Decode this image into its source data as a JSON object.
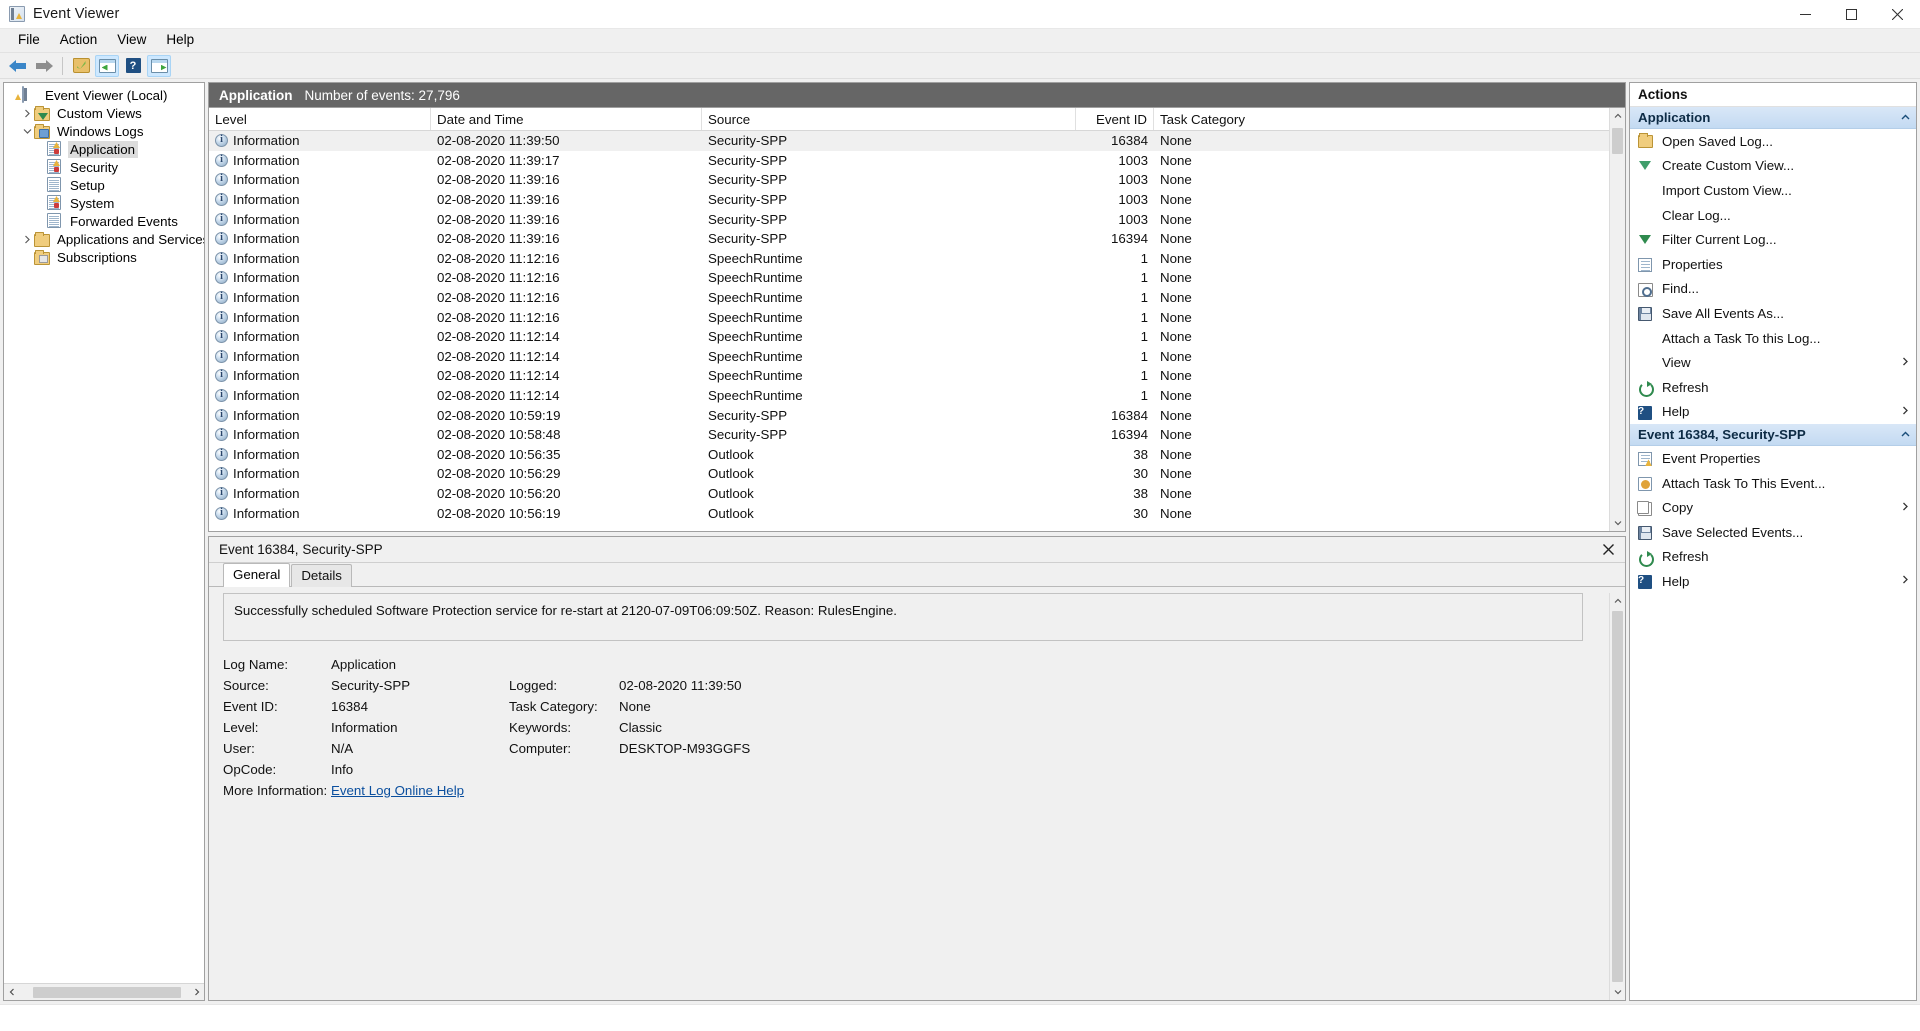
{
  "window": {
    "title": "Event Viewer",
    "icon": "event-viewer-icon",
    "minimize": "minimize-icon",
    "maximize": "maximize-icon",
    "close": "close-icon"
  },
  "menubar": {
    "items": [
      {
        "label": "File"
      },
      {
        "label": "Action"
      },
      {
        "label": "View"
      },
      {
        "label": "Help"
      }
    ]
  },
  "toolbar": {
    "buttons": [
      {
        "name": "back-button",
        "icon": "arrow-left-icon"
      },
      {
        "name": "forward-button",
        "icon": "arrow-right-icon"
      },
      {
        "name": "open-saved-log-button",
        "icon": "folder-open-icon"
      },
      {
        "name": "show-hide-console-tree-button",
        "icon": "console-tree-icon"
      },
      {
        "name": "help-button",
        "icon": "help-icon"
      },
      {
        "name": "show-hide-action-pane-button",
        "icon": "action-pane-icon"
      }
    ]
  },
  "tree": {
    "nodes": [
      {
        "label": "Event Viewer (Local)",
        "icon": "event-viewer-icon",
        "indent": 0,
        "twisty": "none",
        "selected": false
      },
      {
        "label": "Custom Views",
        "icon": "folder-filter-icon",
        "indent": 1,
        "twisty": "collapsed",
        "selected": false
      },
      {
        "label": "Windows Logs",
        "icon": "folder-computer-icon",
        "indent": 1,
        "twisty": "expanded",
        "selected": false
      },
      {
        "label": "Application",
        "icon": "log-warning-icon",
        "indent": 2,
        "twisty": "none",
        "selected": true
      },
      {
        "label": "Security",
        "icon": "log-warning-icon",
        "indent": 2,
        "twisty": "none",
        "selected": false
      },
      {
        "label": "Setup",
        "icon": "log-icon",
        "indent": 2,
        "twisty": "none",
        "selected": false
      },
      {
        "label": "System",
        "icon": "log-warning-icon",
        "indent": 2,
        "twisty": "none",
        "selected": false
      },
      {
        "label": "Forwarded Events",
        "icon": "log-icon",
        "indent": 2,
        "twisty": "none",
        "selected": false
      },
      {
        "label": "Applications and Services Log",
        "icon": "folder-icon",
        "indent": 1,
        "twisty": "collapsed",
        "selected": false
      },
      {
        "label": "Subscriptions",
        "icon": "folder-subscription-icon",
        "indent": 1,
        "twisty": "none",
        "selected": false
      }
    ]
  },
  "log": {
    "name": "Application",
    "count_label": "Number of events: 27,796"
  },
  "grid": {
    "columns": [
      "Level",
      "Date and Time",
      "Source",
      "Event ID",
      "Task Category"
    ],
    "rows": [
      {
        "level": "Information",
        "datetime": "02-08-2020 11:39:50",
        "source": "Security-SPP",
        "event_id": "16384",
        "task": "None",
        "selected": true
      },
      {
        "level": "Information",
        "datetime": "02-08-2020 11:39:17",
        "source": "Security-SPP",
        "event_id": "1003",
        "task": "None",
        "selected": false
      },
      {
        "level": "Information",
        "datetime": "02-08-2020 11:39:16",
        "source": "Security-SPP",
        "event_id": "1003",
        "task": "None",
        "selected": false
      },
      {
        "level": "Information",
        "datetime": "02-08-2020 11:39:16",
        "source": "Security-SPP",
        "event_id": "1003",
        "task": "None",
        "selected": false
      },
      {
        "level": "Information",
        "datetime": "02-08-2020 11:39:16",
        "source": "Security-SPP",
        "event_id": "1003",
        "task": "None",
        "selected": false
      },
      {
        "level": "Information",
        "datetime": "02-08-2020 11:39:16",
        "source": "Security-SPP",
        "event_id": "16394",
        "task": "None",
        "selected": false
      },
      {
        "level": "Information",
        "datetime": "02-08-2020 11:12:16",
        "source": "SpeechRuntime",
        "event_id": "1",
        "task": "None",
        "selected": false
      },
      {
        "level": "Information",
        "datetime": "02-08-2020 11:12:16",
        "source": "SpeechRuntime",
        "event_id": "1",
        "task": "None",
        "selected": false
      },
      {
        "level": "Information",
        "datetime": "02-08-2020 11:12:16",
        "source": "SpeechRuntime",
        "event_id": "1",
        "task": "None",
        "selected": false
      },
      {
        "level": "Information",
        "datetime": "02-08-2020 11:12:16",
        "source": "SpeechRuntime",
        "event_id": "1",
        "task": "None",
        "selected": false
      },
      {
        "level": "Information",
        "datetime": "02-08-2020 11:12:14",
        "source": "SpeechRuntime",
        "event_id": "1",
        "task": "None",
        "selected": false
      },
      {
        "level": "Information",
        "datetime": "02-08-2020 11:12:14",
        "source": "SpeechRuntime",
        "event_id": "1",
        "task": "None",
        "selected": false
      },
      {
        "level": "Information",
        "datetime": "02-08-2020 11:12:14",
        "source": "SpeechRuntime",
        "event_id": "1",
        "task": "None",
        "selected": false
      },
      {
        "level": "Information",
        "datetime": "02-08-2020 11:12:14",
        "source": "SpeechRuntime",
        "event_id": "1",
        "task": "None",
        "selected": false
      },
      {
        "level": "Information",
        "datetime": "02-08-2020 10:59:19",
        "source": "Security-SPP",
        "event_id": "16384",
        "task": "None",
        "selected": false
      },
      {
        "level": "Information",
        "datetime": "02-08-2020 10:58:48",
        "source": "Security-SPP",
        "event_id": "16394",
        "task": "None",
        "selected": false
      },
      {
        "level": "Information",
        "datetime": "02-08-2020 10:56:35",
        "source": "Outlook",
        "event_id": "38",
        "task": "None",
        "selected": false
      },
      {
        "level": "Information",
        "datetime": "02-08-2020 10:56:29",
        "source": "Outlook",
        "event_id": "30",
        "task": "None",
        "selected": false
      },
      {
        "level": "Information",
        "datetime": "02-08-2020 10:56:20",
        "source": "Outlook",
        "event_id": "38",
        "task": "None",
        "selected": false
      },
      {
        "level": "Information",
        "datetime": "02-08-2020 10:56:19",
        "source": "Outlook",
        "event_id": "30",
        "task": "None",
        "selected": false
      }
    ]
  },
  "detail": {
    "title": "Event 16384, Security-SPP",
    "close_icon": "close-icon",
    "tabs": [
      {
        "label": "General",
        "active": true
      },
      {
        "label": "Details",
        "active": false
      }
    ],
    "message": "Successfully scheduled Software Protection service for re-start at 2120-07-09T06:09:50Z. Reason: RulesEngine.",
    "fields": {
      "log_name_label": "Log Name:",
      "log_name_value": "Application",
      "source_label": "Source:",
      "source_value": "Security-SPP",
      "logged_label": "Logged:",
      "logged_value": "02-08-2020 11:39:50",
      "event_id_label": "Event ID:",
      "event_id_value": "16384",
      "task_category_label": "Task Category:",
      "task_category_value": "None",
      "level_label": "Level:",
      "level_value": "Information",
      "keywords_label": "Keywords:",
      "keywords_value": "Classic",
      "user_label": "User:",
      "user_value": "N/A",
      "computer_label": "Computer:",
      "computer_value": "DESKTOP-M93GGFS",
      "opcode_label": "OpCode:",
      "opcode_value": "Info",
      "more_info_label": "More Information:",
      "more_info_link": "Event Log Online Help"
    }
  },
  "actions": {
    "title": "Actions",
    "groups": [
      {
        "header": "Application",
        "chevron": "chevron-up-icon",
        "items": [
          {
            "label": "Open Saved Log...",
            "icon": "open-saved-log-icon",
            "submenu": false
          },
          {
            "label": "Create Custom View...",
            "icon": "create-custom-view-icon",
            "submenu": false
          },
          {
            "label": "Import Custom View...",
            "icon": "none",
            "submenu": false
          },
          {
            "label": "Clear Log...",
            "icon": "none",
            "submenu": false
          },
          {
            "label": "Filter Current Log...",
            "icon": "filter-icon",
            "submenu": false
          },
          {
            "label": "Properties",
            "icon": "properties-icon",
            "submenu": false
          },
          {
            "label": "Find...",
            "icon": "find-icon",
            "submenu": false
          },
          {
            "label": "Save All Events As...",
            "icon": "save-icon",
            "submenu": false
          },
          {
            "label": "Attach a Task To this Log...",
            "icon": "none",
            "submenu": false
          },
          {
            "label": "View",
            "icon": "none",
            "submenu": true
          },
          {
            "label": "Refresh",
            "icon": "refresh-icon",
            "submenu": false
          },
          {
            "label": "Help",
            "icon": "help-icon",
            "submenu": true
          }
        ]
      },
      {
        "header": "Event 16384, Security-SPP",
        "chevron": "chevron-up-icon",
        "items": [
          {
            "label": "Event Properties",
            "icon": "event-properties-icon",
            "submenu": false
          },
          {
            "label": "Attach Task To This Event...",
            "icon": "attach-task-icon",
            "submenu": false
          },
          {
            "label": "Copy",
            "icon": "copy-icon",
            "submenu": true
          },
          {
            "label": "Save Selected Events...",
            "icon": "save-icon",
            "submenu": false
          },
          {
            "label": "Refresh",
            "icon": "refresh-icon",
            "submenu": false
          },
          {
            "label": "Help",
            "icon": "help-icon",
            "submenu": true
          }
        ]
      }
    ]
  }
}
